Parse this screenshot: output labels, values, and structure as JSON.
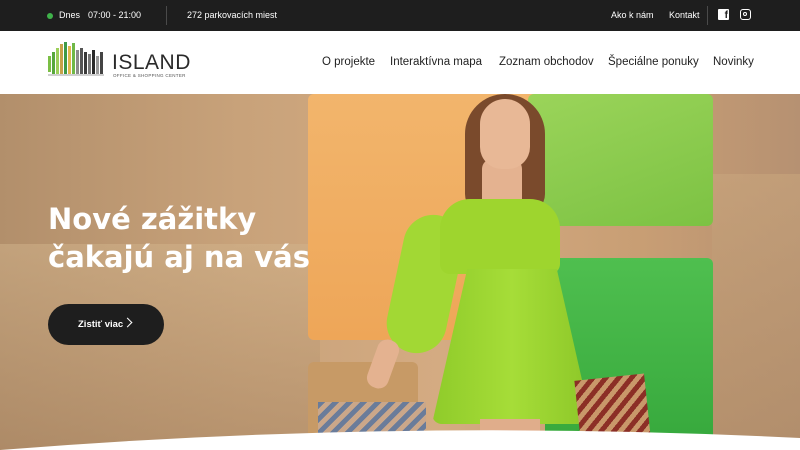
{
  "topbar": {
    "day_label": "Dnes",
    "hours": "07:00 - 21:00",
    "parking": "272 parkovacích miest",
    "about_link": "Ako k nám",
    "contact_link": "Kontakt",
    "status_color": "#3fb24a",
    "icons": [
      "facebook-icon",
      "instagram-icon"
    ]
  },
  "header": {
    "logo_text": "ISLAND",
    "logo_subtitle": "OFFICE & SHOPPING CENTER",
    "nav": [
      "O projekte",
      "Interaktívna mapa",
      "Zoznam obchodov",
      "Špeciálne ponuky",
      "Novinky"
    ]
  },
  "hero": {
    "title_line1": "Nové zážitky",
    "title_line2": "čakajú aj na vás",
    "cta_label": "Zistiť viac",
    "accent_colors": [
      "#f2b56c",
      "#9bd45a",
      "#4fbf4f"
    ]
  }
}
